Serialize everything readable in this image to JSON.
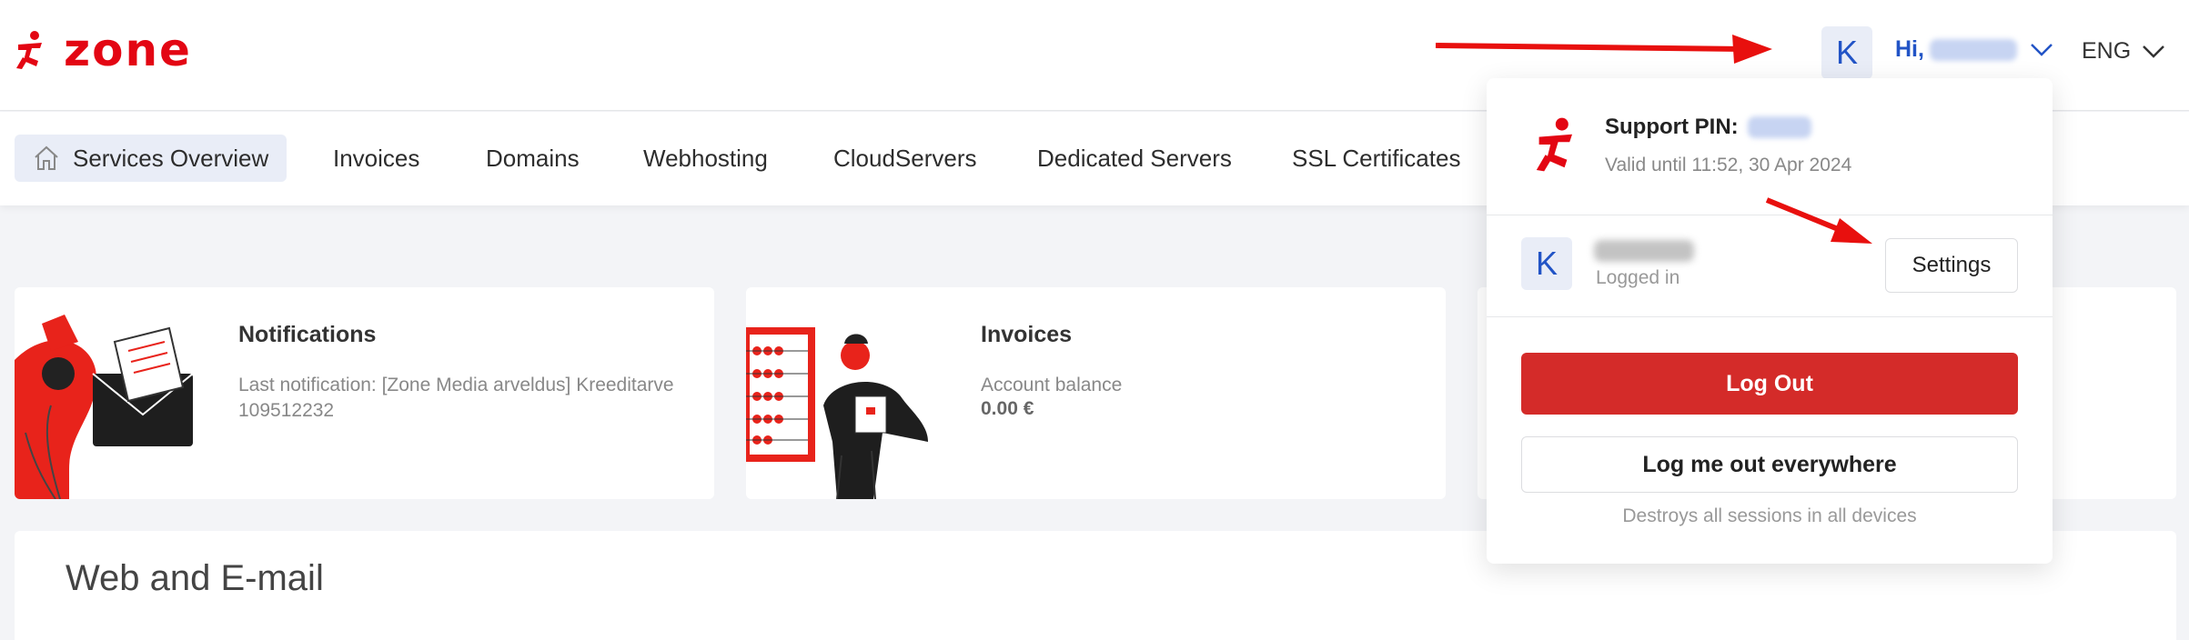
{
  "header": {
    "logo_text": "zone",
    "avatar_initial": "K",
    "greeting": "Hi,",
    "language": "ENG"
  },
  "nav": {
    "items": [
      {
        "label": "Services Overview",
        "active": true
      },
      {
        "label": "Invoices"
      },
      {
        "label": "Domains"
      },
      {
        "label": "Webhosting"
      },
      {
        "label": "CloudServers"
      },
      {
        "label": "Dedicated Servers"
      },
      {
        "label": "SSL Certificates"
      }
    ]
  },
  "cards": {
    "notifications": {
      "title": "Notifications",
      "text": "Last notification: [Zone Media arveldus] Kreeditarve 109512232"
    },
    "invoices": {
      "title": "Invoices",
      "balance_label": "Account balance",
      "balance_value": "0.00 €"
    }
  },
  "section": {
    "title": "Web and E-mail"
  },
  "dropdown": {
    "pin_label": "Support PIN:",
    "valid_until": "Valid until 11:52, 30 Apr 2024",
    "user_initial": "K",
    "logged_in": "Logged in",
    "settings_label": "Settings",
    "logout_label": "Log Out",
    "logout_everywhere_label": "Log me out everywhere",
    "logout_everywhere_note": "Destroys all sessions in all devices"
  },
  "colors": {
    "brand_red": "#e30613",
    "accent_blue": "#2254c6",
    "logout_red": "#d42b29",
    "arrow_red": "#e8100e"
  }
}
